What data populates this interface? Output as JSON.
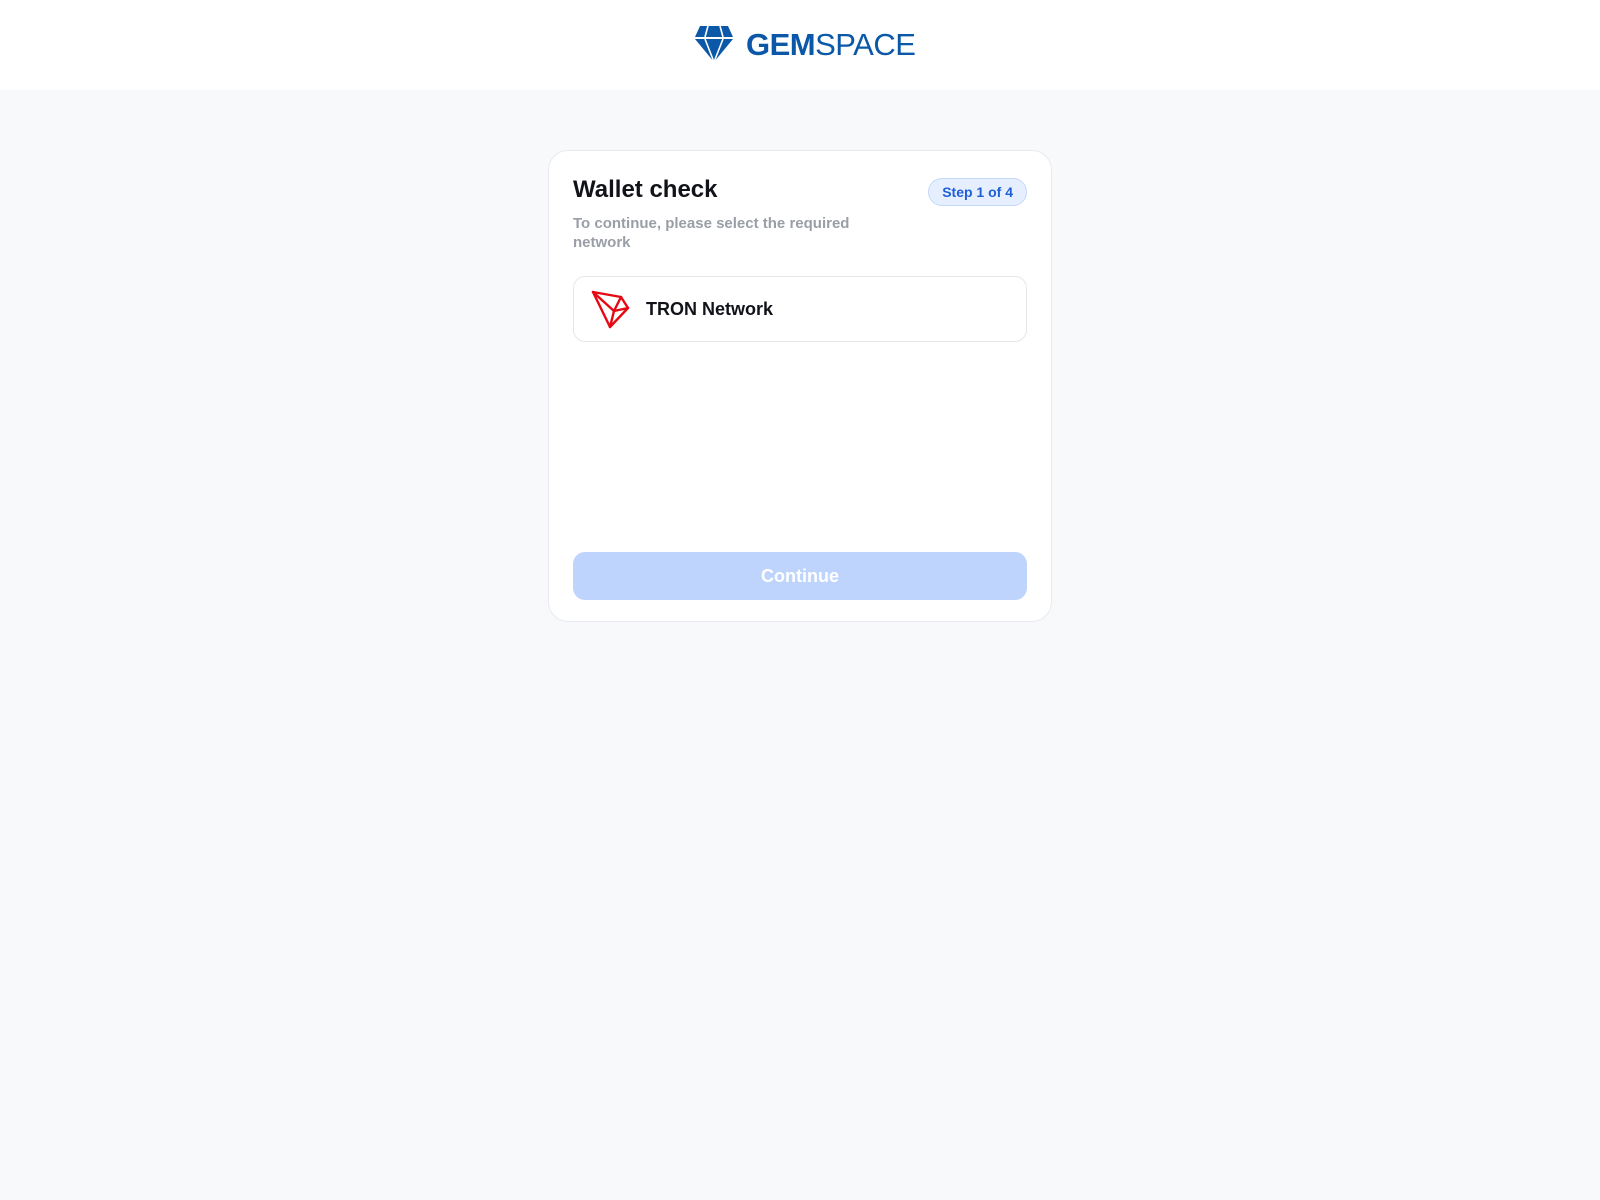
{
  "header": {
    "logo_icon": "diamond-gem-icon",
    "logo_text_bold": "GEM",
    "logo_text_regular": "SPACE",
    "brand_color": "#0b57a8"
  },
  "card": {
    "title": "Wallet check",
    "step_badge": "Step 1 of 4",
    "subtitle": "To continue, please select the required network",
    "networks": [
      {
        "label": "TRON Network",
        "icon": "tron-logo-icon",
        "icon_color": "#e50914"
      }
    ],
    "continue_label": "Continue",
    "continue_enabled": false,
    "accent_color": "#1f5fd6"
  }
}
